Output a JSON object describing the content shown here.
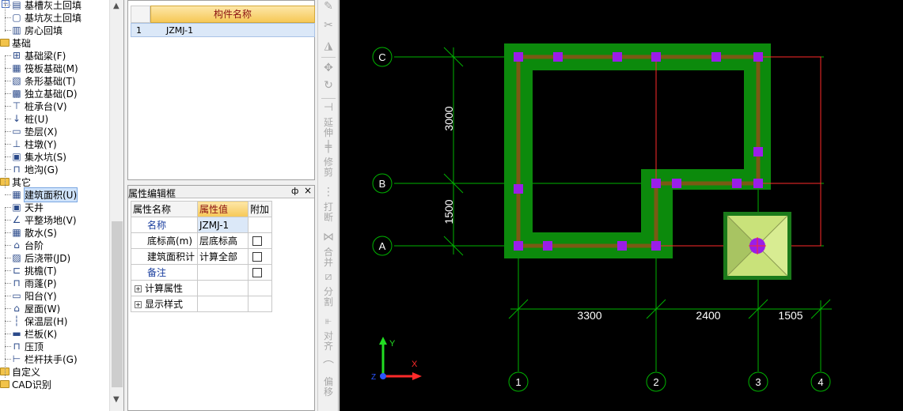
{
  "tree": {
    "items": [
      {
        "label": "基槽灰土回填",
        "kind": "item",
        "icon": "foundation-trench-icon"
      },
      {
        "label": "基坑灰土回填",
        "kind": "item",
        "icon": "pit-fill-icon"
      },
      {
        "label": "房心回填",
        "kind": "item",
        "icon": "room-fill-icon"
      },
      {
        "label": "基础",
        "kind": "cat",
        "icon": "folder-icon"
      },
      {
        "label": "基础梁(F)",
        "kind": "item",
        "icon": "beam-icon"
      },
      {
        "label": "筏板基础(M)",
        "kind": "item",
        "icon": "raft-icon"
      },
      {
        "label": "条形基础(T)",
        "kind": "item",
        "icon": "strip-icon"
      },
      {
        "label": "独立基础(D)",
        "kind": "item",
        "icon": "isolated-icon"
      },
      {
        "label": "桩承台(V)",
        "kind": "item",
        "icon": "pile-cap-icon"
      },
      {
        "label": "桩(U)",
        "kind": "item",
        "icon": "pile-icon"
      },
      {
        "label": "垫层(X)",
        "kind": "item",
        "icon": "cushion-icon"
      },
      {
        "label": "柱墩(Y)",
        "kind": "item",
        "icon": "pier-icon"
      },
      {
        "label": "集水坑(S)",
        "kind": "item",
        "icon": "sump-icon"
      },
      {
        "label": "地沟(G)",
        "kind": "item",
        "icon": "trench-icon"
      },
      {
        "label": "其它",
        "kind": "cat",
        "icon": "folder-icon"
      },
      {
        "label": "建筑面积(U)",
        "kind": "item",
        "icon": "area-icon",
        "selected": true
      },
      {
        "label": "天井",
        "kind": "item",
        "icon": "patio-icon"
      },
      {
        "label": "平整场地(V)",
        "kind": "item",
        "icon": "leveling-icon"
      },
      {
        "label": "散水(S)",
        "kind": "item",
        "icon": "apron-icon"
      },
      {
        "label": "台阶",
        "kind": "item",
        "icon": "step-icon"
      },
      {
        "label": "后浇带(JD)",
        "kind": "item",
        "icon": "post-cast-icon"
      },
      {
        "label": "挑檐(T)",
        "kind": "item",
        "icon": "eave-icon"
      },
      {
        "label": "雨蓬(P)",
        "kind": "item",
        "icon": "canopy-icon"
      },
      {
        "label": "阳台(Y)",
        "kind": "item",
        "icon": "balcony-icon"
      },
      {
        "label": "屋面(W)",
        "kind": "item",
        "icon": "roof-icon"
      },
      {
        "label": "保温层(H)",
        "kind": "item",
        "icon": "insulation-icon"
      },
      {
        "label": "栏板(K)",
        "kind": "item",
        "icon": "parapet-icon"
      },
      {
        "label": "压顶",
        "kind": "item",
        "icon": "coping-icon"
      },
      {
        "label": "栏杆扶手(G)",
        "kind": "item",
        "icon": "railing-icon"
      },
      {
        "label": "自定义",
        "kind": "cat",
        "icon": "folder-icon"
      },
      {
        "label": "CAD识别",
        "kind": "cat",
        "icon": "folder-icon"
      }
    ]
  },
  "component_list": {
    "header": "构件名称",
    "rows": [
      {
        "num": "1",
        "name": "JZMJ-1"
      }
    ]
  },
  "property_panel": {
    "title": "属性编辑框",
    "pin_glyph": "ф",
    "close_glyph": "×",
    "headers": [
      "属性名称",
      "属性值",
      "附加"
    ],
    "rows": [
      {
        "name": "名称",
        "value": "JZMJ-1",
        "blue": true,
        "check": false
      },
      {
        "name": "底标高(m)",
        "value": "层底标高",
        "check": true
      },
      {
        "name": "建筑面积计",
        "value": "计算全部",
        "check": true
      },
      {
        "name": "备注",
        "value": "",
        "blue": true,
        "check": true
      },
      {
        "name": "计算属性",
        "value": "",
        "expand": true
      },
      {
        "name": "显示样式",
        "value": "",
        "expand": true
      }
    ]
  },
  "vertical_toolbar": {
    "labels": [
      "延伸",
      "修剪",
      "打断",
      "合并",
      "分割",
      "对齐",
      "偏移"
    ]
  },
  "cad": {
    "axes_h": [
      "C",
      "B",
      "A"
    ],
    "axes_v": [
      "1",
      "2",
      "3",
      "4"
    ],
    "dims_h": [
      "3300",
      "2400",
      "1505"
    ],
    "dims_v": [
      "3000",
      "1500"
    ],
    "ucs": {
      "x": "X",
      "y": "Y",
      "z": "Z"
    },
    "colors": {
      "background": "#000000",
      "axis_line": "#00b400",
      "area_fill": "#0c8a0c",
      "wall_core": "#7a5a14",
      "boundary": "#ff2a2a",
      "grip": "#9a1ee8",
      "column_fill": "#c9e27a",
      "column_border": "#1a7a1a",
      "dim_text": "#ffffff"
    }
  }
}
